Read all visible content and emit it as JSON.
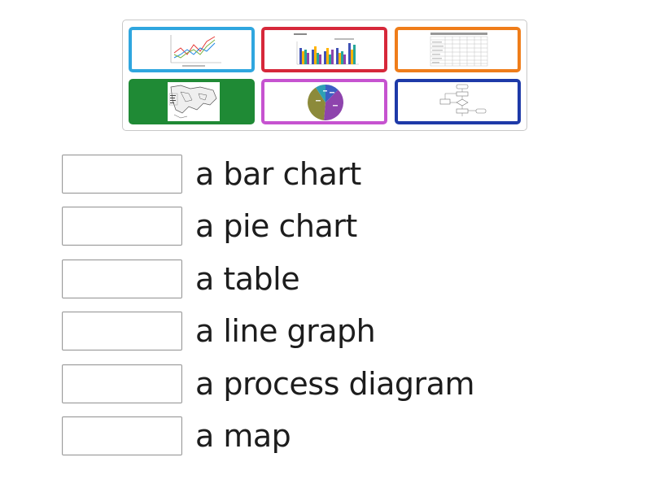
{
  "tiles": [
    {
      "id": "line-graph",
      "border_color": "#2fa6df"
    },
    {
      "id": "bar-chart",
      "border_color": "#d6283a"
    },
    {
      "id": "table",
      "border_color": "#ef7d1a"
    },
    {
      "id": "map",
      "border_color": "#1f8a35"
    },
    {
      "id": "pie-chart",
      "border_color": "#c653d0"
    },
    {
      "id": "process-diagram",
      "border_color": "#1e3aa8"
    }
  ],
  "answers": [
    {
      "label": "a bar chart"
    },
    {
      "label": "a pie chart"
    },
    {
      "label": "a table"
    },
    {
      "label": "a line graph"
    },
    {
      "label": "a process diagram"
    },
    {
      "label": "a map"
    }
  ]
}
